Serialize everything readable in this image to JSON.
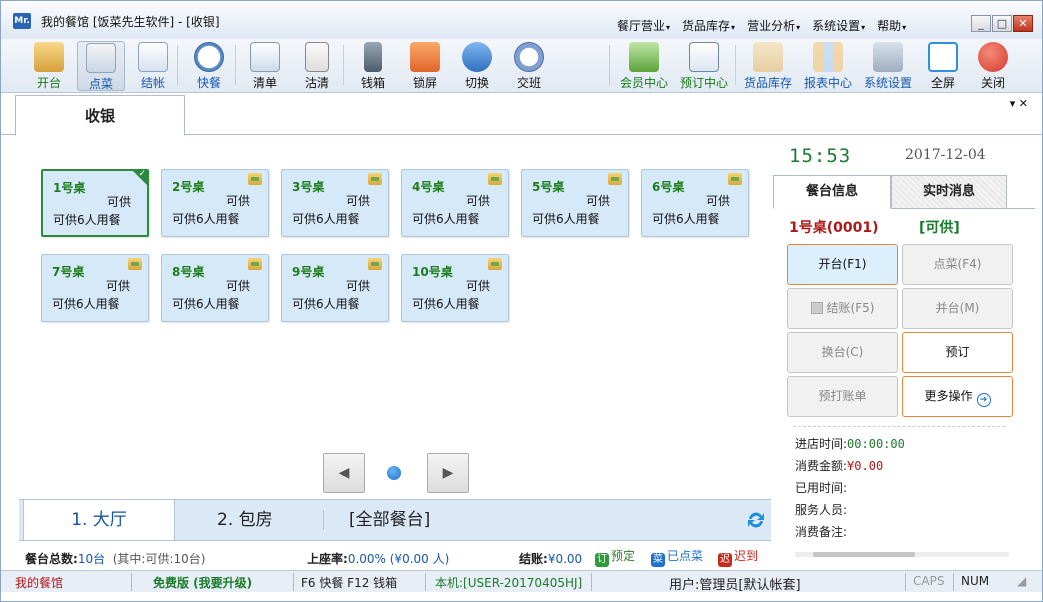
{
  "titlebar": {
    "logo": "Mr.",
    "title": "我的餐馆 [饭菜先生软件] - [收银]",
    "menus": [
      "餐厅营业",
      "货品库存",
      "营业分析",
      "系统设置",
      "帮助"
    ]
  },
  "toolbar": {
    "left": [
      {
        "label": "开台",
        "icon": "open-table-icon"
      },
      {
        "label": "点菜",
        "icon": "order-icon"
      },
      {
        "label": "结帐",
        "icon": "checkout-icon"
      },
      {
        "label": "快餐",
        "icon": "fastfood-clock-icon"
      },
      {
        "label": "清单",
        "icon": "list-icon"
      },
      {
        "label": "沽清",
        "icon": "soldout-icon"
      },
      {
        "label": "钱箱",
        "icon": "cashbox-icon"
      },
      {
        "label": "锁屏",
        "icon": "lock-icon"
      },
      {
        "label": "切换",
        "icon": "switch-user-icon"
      },
      {
        "label": "交班",
        "icon": "handover-icon"
      }
    ],
    "right": [
      {
        "label": "会员中心",
        "icon": "member-icon"
      },
      {
        "label": "预订中心",
        "icon": "reservation-icon"
      },
      {
        "label": "货品库存",
        "icon": "inventory-icon"
      },
      {
        "label": "报表中心",
        "icon": "report-icon"
      },
      {
        "label": "系统设置",
        "icon": "settings-icon"
      },
      {
        "label": "全屏",
        "icon": "fullscreen-icon"
      },
      {
        "label": "关闭",
        "icon": "power-icon"
      }
    ]
  },
  "tab": {
    "title": "收银",
    "ctrl": "▾ ✕"
  },
  "tables": [
    {
      "name": "1号桌",
      "status": "可供",
      "capacity": "可供6人用餐",
      "selected": true
    },
    {
      "name": "2号桌",
      "status": "可供",
      "capacity": "可供6人用餐"
    },
    {
      "name": "3号桌",
      "status": "可供",
      "capacity": "可供6人用餐"
    },
    {
      "name": "4号桌",
      "status": "可供",
      "capacity": "可供6人用餐"
    },
    {
      "name": "5号桌",
      "status": "可供",
      "capacity": "可供6人用餐"
    },
    {
      "name": "6号桌",
      "status": "可供",
      "capacity": "可供6人用餐"
    },
    {
      "name": "7号桌",
      "status": "可供",
      "capacity": "可供6人用餐"
    },
    {
      "name": "8号桌",
      "status": "可供",
      "capacity": "可供6人用餐"
    },
    {
      "name": "9号桌",
      "status": "可供",
      "capacity": "可供6人用餐"
    },
    {
      "name": "10号桌",
      "status": "可供",
      "capacity": "可供6人用餐"
    }
  ],
  "pager": {
    "prev": "◀",
    "next": "▶"
  },
  "areas": {
    "a1": "1. 大厅",
    "a2": "2. 包房",
    "a3": "[全部餐台]"
  },
  "stats": {
    "total_label": "餐台总数:",
    "total_value": "10台",
    "total_detail": "(其中:可供:10台)",
    "rate_label": "上座率:",
    "rate_value": "0.00% (¥0.00 人)",
    "settle_label": "结账:",
    "settle_value": "¥0.00",
    "legend": [
      {
        "icon": "订",
        "label": "预定",
        "color": "#2e9a3c"
      },
      {
        "icon": "菜",
        "label": "已点菜",
        "color": "#1f6fcc"
      },
      {
        "icon": "迟",
        "label": "迟到",
        "color": "#c52a1a"
      }
    ]
  },
  "statusbar": {
    "app": "我的餐馆",
    "edition": "免费版 (我要升级)",
    "keys": "F6 快餐 F12 钱箱",
    "machine": "本机:[USER-20170405HJ]",
    "user": "用户:管理员[默认帐套]",
    "caps": "CAPS",
    "num": "NUM"
  },
  "right": {
    "time": "15:53",
    "date": "2017-12-04",
    "tabs": [
      "餐台信息",
      "实时消息"
    ],
    "table_title": "1号桌(0001)",
    "table_status": "[可供]",
    "actions": [
      {
        "label": "开台(F1)",
        "style": "blue"
      },
      {
        "label": "点菜(F4)",
        "style": "disabled"
      },
      {
        "label": "结账(F5)",
        "style": "disabled"
      },
      {
        "label": "并台(M)",
        "style": "disabled"
      },
      {
        "label": "换台(C)",
        "style": "disabled"
      },
      {
        "label": "预订",
        "style": "hi"
      },
      {
        "label": "预打账单",
        "style": "disabled"
      },
      {
        "label": "更多操作",
        "style": "hi"
      }
    ],
    "info": [
      {
        "label": "进店时间:",
        "value": "00:00:00"
      },
      {
        "label": "消费金额:",
        "value": "¥0.00"
      },
      {
        "label": "已用时间:",
        "value": ""
      },
      {
        "label": "服务人员:",
        "value": ""
      },
      {
        "label": "消费备注:",
        "value": ""
      }
    ]
  }
}
